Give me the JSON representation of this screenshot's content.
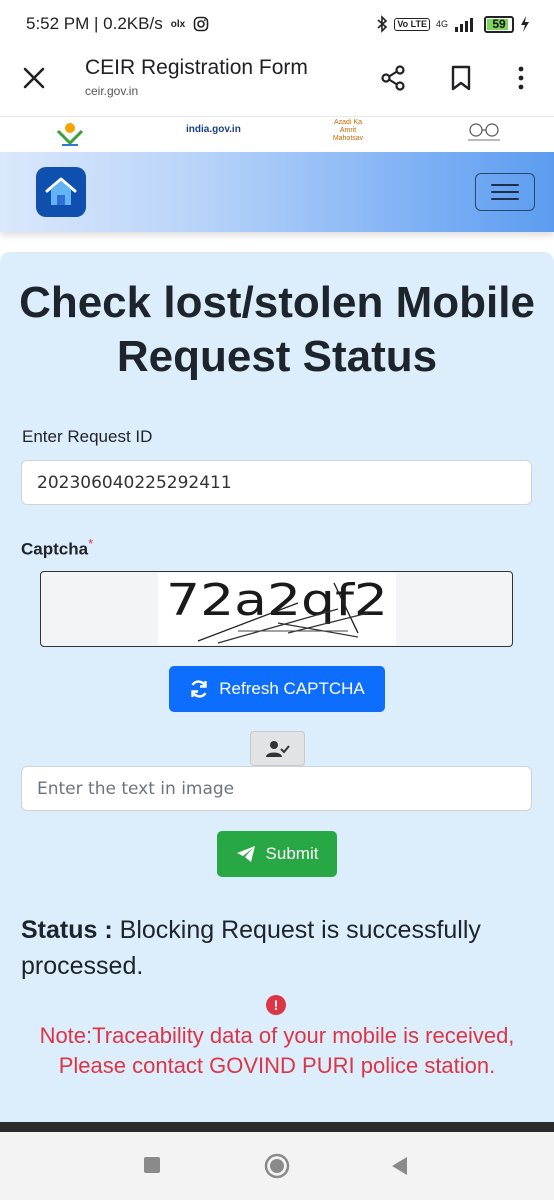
{
  "statusbar": {
    "time": "5:52 PM | 0.2KB/s",
    "icons": [
      "olx-icon",
      "instagram-icon",
      "bluetooth-icon",
      "volte-icon",
      "4g-icon",
      "signal-icon",
      "battery-icon",
      "charging-icon"
    ],
    "volte_text": "Vo LTE",
    "network_text": "4G",
    "battery_level": "59"
  },
  "browser": {
    "title": "CEIR Registration Form",
    "url": "ceir.gov.in"
  },
  "logos": {
    "india_gov": "india.gov.in",
    "azadi": "Azadi Ka Amrit Mahotsav"
  },
  "main": {
    "heading": "Check lost/stolen Mobile Request Status",
    "request_id_label": "Enter Request ID",
    "request_id_value": "202306040225292411",
    "captcha_label": "Captcha",
    "captcha_required_mark": "*",
    "captcha_image_text": "72a2qf2",
    "refresh_label": "Refresh CAPTCHA",
    "captcha_placeholder": "Enter the text in image",
    "submit_label": "Submit",
    "status_label": "Status :",
    "status_text": "Blocking Request is successfully processed.",
    "note_text": "Note:Traceability data of your mobile is received, Please contact GOVIND PURI police station."
  },
  "colors": {
    "primary": "#0d6efd",
    "success": "#28a745",
    "danger": "#dc3545",
    "card_bg": "#dcedfc"
  }
}
